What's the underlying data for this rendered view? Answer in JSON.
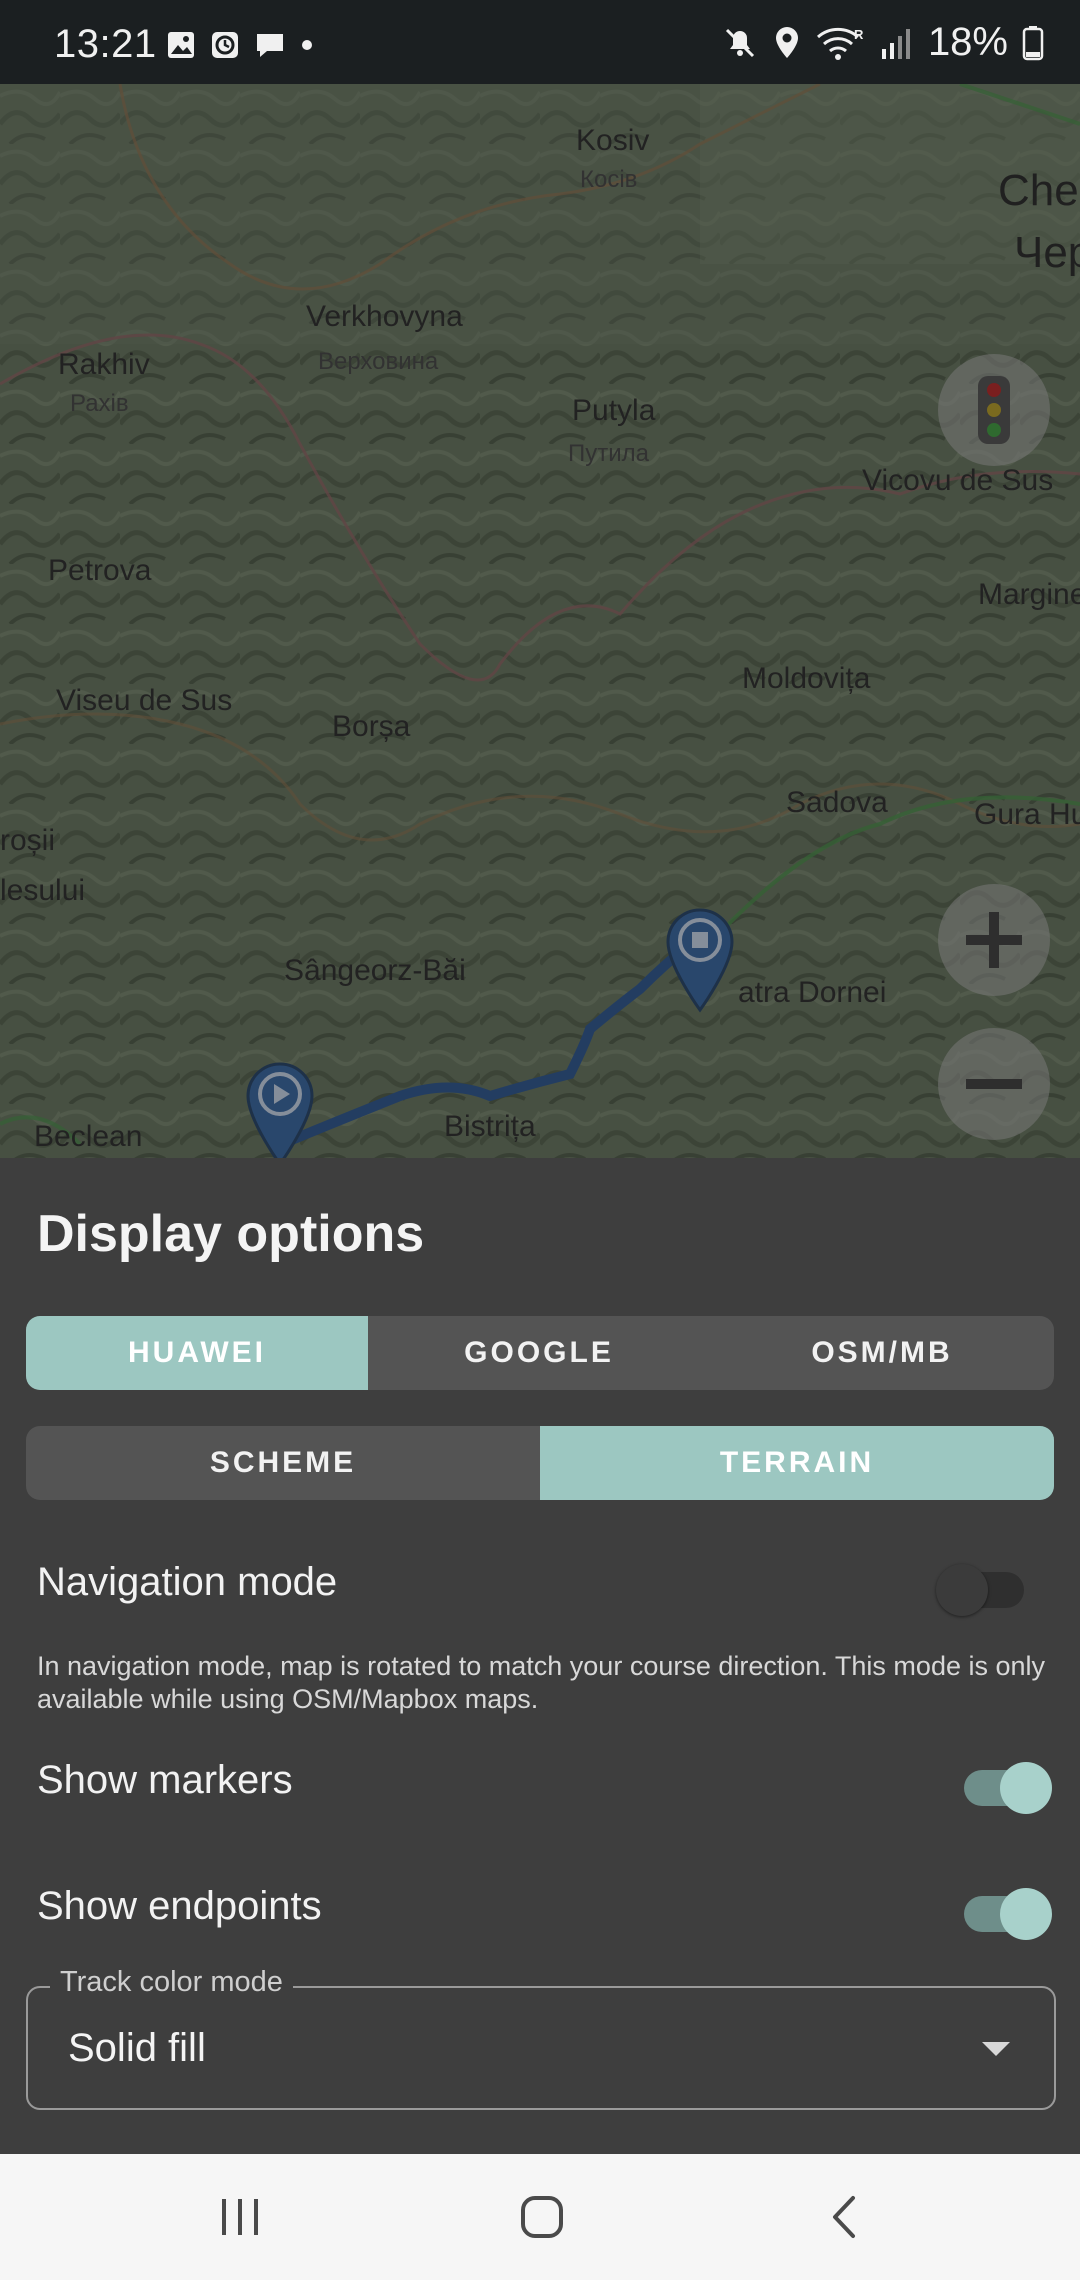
{
  "status_bar": {
    "time": "13:21",
    "left_icons": [
      "gallery-icon",
      "clock-icon",
      "chat-icon",
      "dot-icon"
    ],
    "right_icons": [
      "mute-icon",
      "location-icon",
      "wifi-icon",
      "signal-icon",
      "battery-icon"
    ],
    "battery": "18%"
  },
  "map": {
    "labels": [
      {
        "text": "Kosiv"
      },
      {
        "text": "Косів"
      },
      {
        "text": "Che"
      },
      {
        "text": "Чер"
      },
      {
        "text": "Verkhovyna"
      },
      {
        "text": "Верховина"
      },
      {
        "text": "Rakhiv"
      },
      {
        "text": "Рахів"
      },
      {
        "text": "Putyla"
      },
      {
        "text": "Путила"
      },
      {
        "text": "Vicovu de Sus"
      },
      {
        "text": "Petrova"
      },
      {
        "text": "Margine"
      },
      {
        "text": "Moldovița"
      },
      {
        "text": "Viseu de Sus"
      },
      {
        "text": "Borșa"
      },
      {
        "text": "Sadova"
      },
      {
        "text": "Gura Hu"
      },
      {
        "text": "roșii"
      },
      {
        "text": "lesului"
      },
      {
        "text": "Sângeorz-Băi"
      },
      {
        "text": "atra Dornei"
      },
      {
        "text": "Beclean"
      },
      {
        "text": "Bistrița"
      }
    ],
    "traffic_icon": "traffic-light-icon",
    "zoom_in_icon": "plus-icon",
    "zoom_out_icon": "minus-icon",
    "track_color": "#1f4d8a",
    "start_marker_icon": "play-icon",
    "end_marker_icon": "stop-icon"
  },
  "sheet": {
    "title": "Display options",
    "provider_tabs": [
      {
        "label": "HUAWEI",
        "selected": true
      },
      {
        "label": "GOOGLE",
        "selected": false
      },
      {
        "label": "OSM/MB",
        "selected": false
      }
    ],
    "map_type_tabs": [
      {
        "label": "SCHEME",
        "selected": false
      },
      {
        "label": "TERRAIN",
        "selected": true
      }
    ],
    "navigation_mode": {
      "label": "Navigation mode",
      "enabled": false,
      "description": "In navigation mode, map is rotated to match your course direction. This mode is only available while using OSM/Mapbox maps."
    },
    "show_markers": {
      "label": "Show markers",
      "enabled": true
    },
    "show_endpoints": {
      "label": "Show endpoints",
      "enabled": true
    },
    "track_color_mode": {
      "legend": "Track color mode",
      "value": "Solid fill"
    },
    "accent_color": "#9cc7c1"
  },
  "nav_bar": {
    "recents_icon": "recents-icon",
    "home_icon": "home-icon",
    "back_icon": "back-icon"
  }
}
